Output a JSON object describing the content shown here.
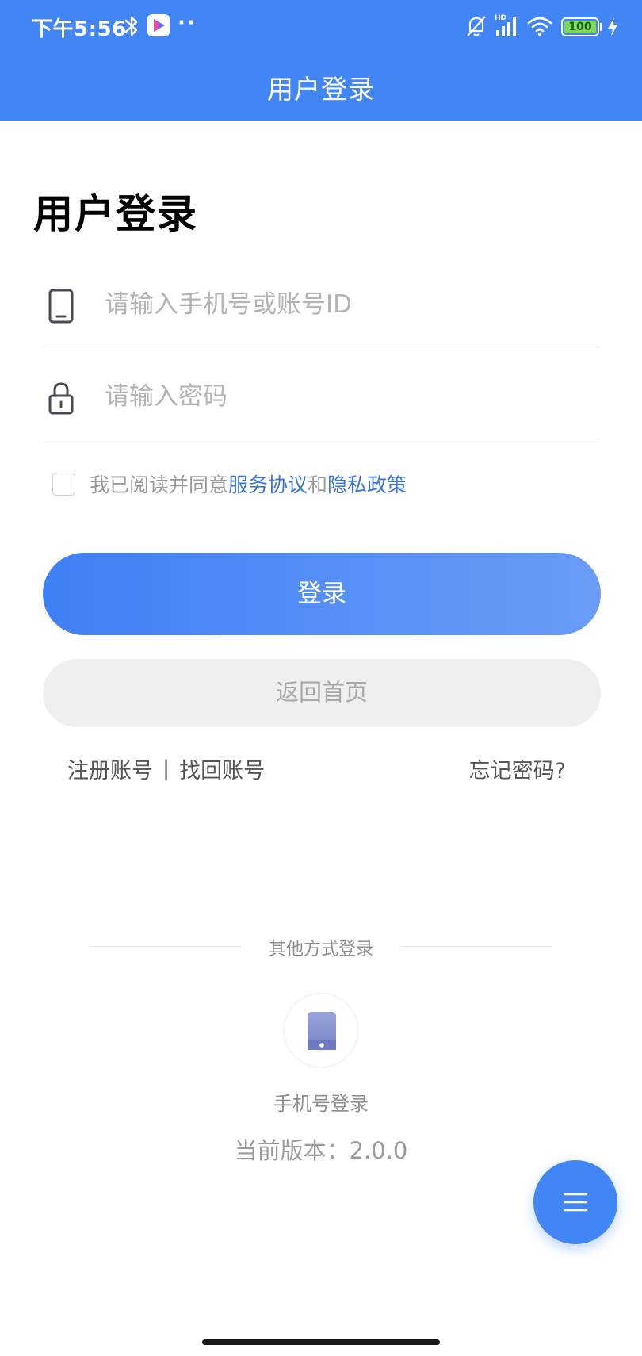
{
  "status_bar": {
    "time": "下午5:56",
    "more": "··",
    "battery": "100"
  },
  "header": {
    "title": "用户登录"
  },
  "page": {
    "title": "用户登录"
  },
  "form": {
    "account_placeholder": "请输入手机号或账号ID",
    "password_placeholder": "请输入密码",
    "agreement": {
      "prefix": "我已阅读并同意",
      "service_link": "服务协议",
      "connector": "和",
      "privacy_link": "隐私政策"
    },
    "login_label": "登录",
    "home_label": "返回首页"
  },
  "links": {
    "register": "注册账号",
    "separator": "|",
    "recover": "找回账号",
    "forgot": "忘记密码?"
  },
  "other_login": {
    "divider": "其他方式登录",
    "phone_label": "手机号登录"
  },
  "version": {
    "text": "当前版本：2.0.0"
  },
  "colors": {
    "primary": "#4285f4",
    "link": "#3c74d8",
    "battery": "#7ed957"
  }
}
